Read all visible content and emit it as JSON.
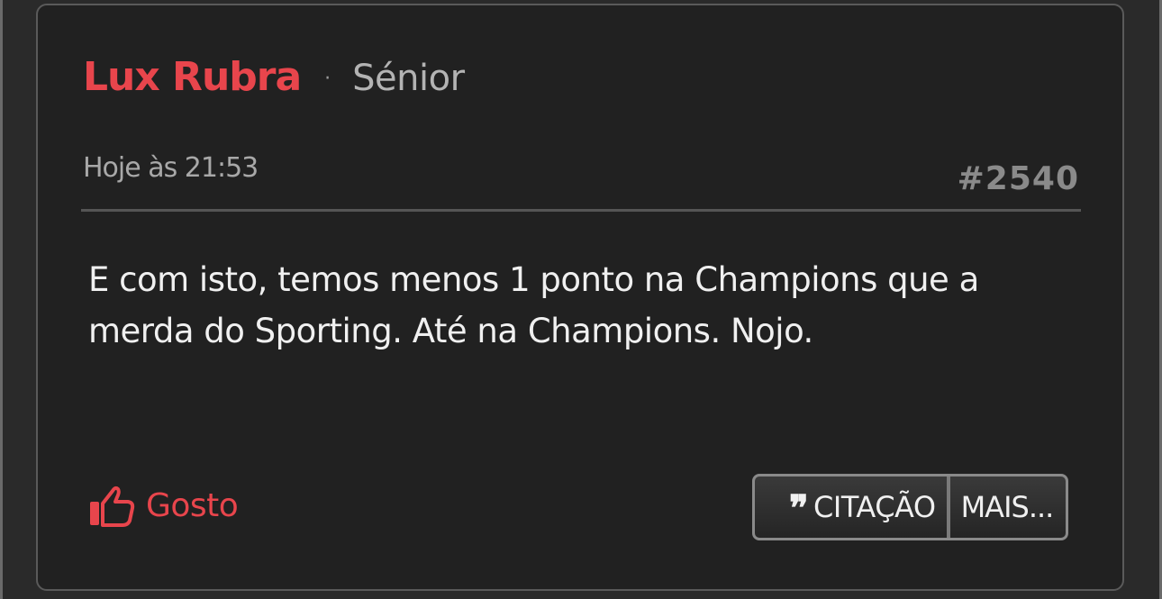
{
  "post": {
    "author": "Lux Rubra",
    "separator": "·",
    "rank": "Sénior",
    "date": "Hoje às 21:53",
    "number": "#2540",
    "body_line1": "E com isto, temos menos 1 ponto na Champions que a",
    "body_line2": "merda do Sporting. Até na Champions. Nojo."
  },
  "actions": {
    "like_label": "Gosto",
    "like_icon": "thumbs-up-icon",
    "quote_icon": "quote-icon",
    "quote_glyph": "❞",
    "quote_label": "CITAÇÃO",
    "more_label": "MAIS..."
  },
  "colors": {
    "accent": "#e8454c",
    "card_background": "#212121",
    "page_background": "#2a2a2a",
    "text": "#f0f0f0",
    "muted": "#a8a8a8"
  }
}
